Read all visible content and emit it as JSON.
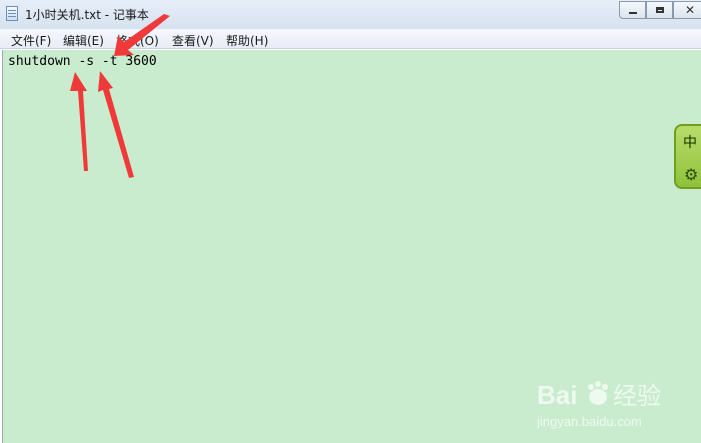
{
  "window": {
    "title": "1小时关机.txt - 记事本"
  },
  "menu": {
    "items": [
      "文件(F)",
      "编辑(E)",
      "格式(O)",
      "查看(V)",
      "帮助(H)"
    ]
  },
  "editor": {
    "content": "shutdown -s -t 3600",
    "background_color": "#c9ecce"
  },
  "ime": {
    "label": "中",
    "icon": "gear-icon",
    "color": "#8fc23a"
  },
  "watermark": {
    "logo": "Baidu经验",
    "url": "jingyan.baidu.com"
  },
  "annotation": {
    "arrow_color": "#f03a3a",
    "icon": "arrow-icon"
  }
}
